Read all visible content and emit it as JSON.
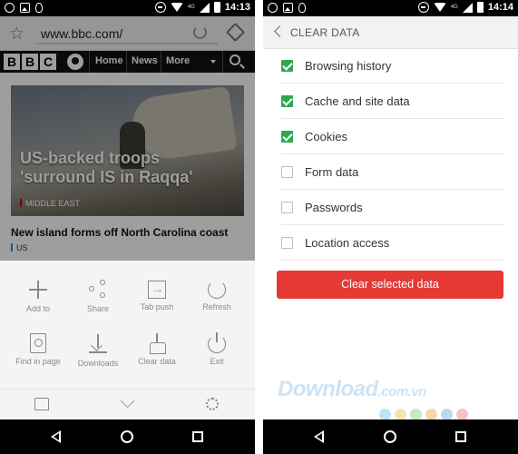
{
  "left_phone": {
    "statusbar": {
      "time": "14:13",
      "network": "4G"
    },
    "address_bar": {
      "url": "www.bbc.com/"
    },
    "bbc_nav": {
      "logo": [
        "B",
        "B",
        "C"
      ],
      "links": [
        "Home",
        "News",
        "More"
      ]
    },
    "page": {
      "headline": "US-backed troops 'surround IS in Raqqa'",
      "headline_tag": "MIDDLE EAST",
      "story2_title": "New island forms off North Carolina coast",
      "story2_tag": "US"
    },
    "menu": {
      "row1": [
        "Add to",
        "Share",
        "Tab push",
        "Refresh"
      ],
      "row2": [
        "Find in page",
        "Downloads",
        "Clear data",
        "Exit"
      ]
    }
  },
  "right_phone": {
    "statusbar": {
      "time": "14:14",
      "network": "4G"
    },
    "header": {
      "title": "CLEAR DATA"
    },
    "options": [
      {
        "label": "Browsing history",
        "checked": true
      },
      {
        "label": "Cache and site data",
        "checked": true
      },
      {
        "label": "Cookies",
        "checked": true
      },
      {
        "label": "Form data",
        "checked": false
      },
      {
        "label": "Passwords",
        "checked": false
      },
      {
        "label": "Location access",
        "checked": false
      }
    ],
    "button": {
      "label": "Clear selected data"
    }
  },
  "watermark": {
    "text": "Download",
    "domain": ".com.vn"
  },
  "colors": {
    "accent_red": "#e53935",
    "check_green": "#2fa84f",
    "watermark_dots": [
      "#bfe3f5",
      "#f3e7b0",
      "#c8e8c2",
      "#f7d6a8",
      "#bcd9f2",
      "#f5c3c3"
    ]
  }
}
